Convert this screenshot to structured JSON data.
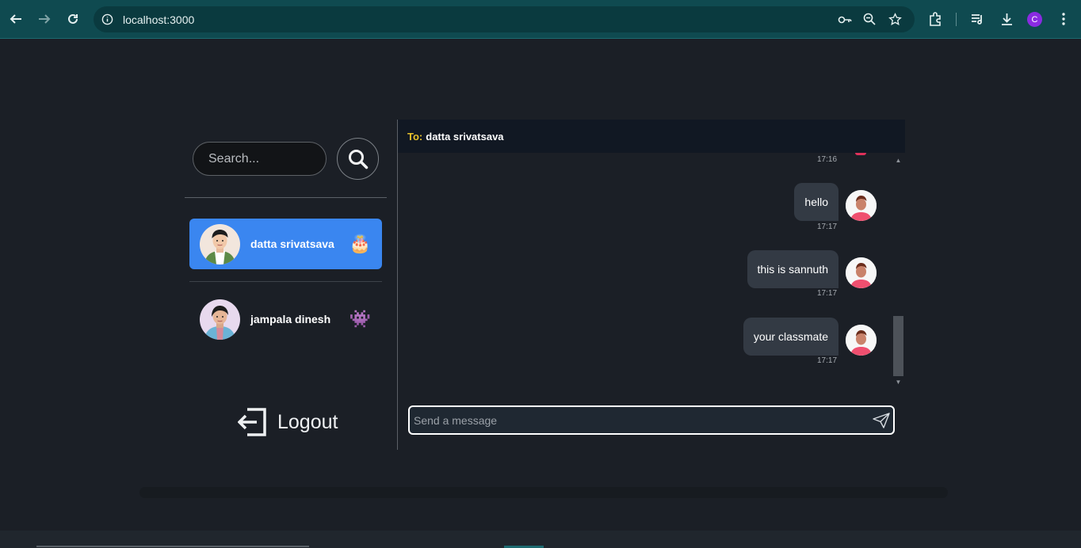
{
  "browser": {
    "url": "localhost:3000",
    "profile_initial": "C"
  },
  "sidebar": {
    "search_placeholder": "Search...",
    "conversations": [
      {
        "name": "datta srivatsava",
        "emoji": "🎂",
        "active": true
      },
      {
        "name": "jampala dinesh",
        "emoji": "👾",
        "active": false
      }
    ],
    "logout_label": "Logout"
  },
  "chat": {
    "to_label": "To:",
    "recipient": "datta srivatsava",
    "first_timestamp": "17:16",
    "messages": [
      {
        "text": "hello",
        "time": "17:17"
      },
      {
        "text": "this is sannuth",
        "time": "17:17"
      },
      {
        "text": "your classmate",
        "time": "17:17"
      }
    ],
    "input_placeholder": "Send a message"
  },
  "colors": {
    "background": "#1b1f26",
    "active_conversation": "#3a86f0",
    "to_label": "#e8c12b",
    "browser_chrome": "#0f4a50"
  }
}
